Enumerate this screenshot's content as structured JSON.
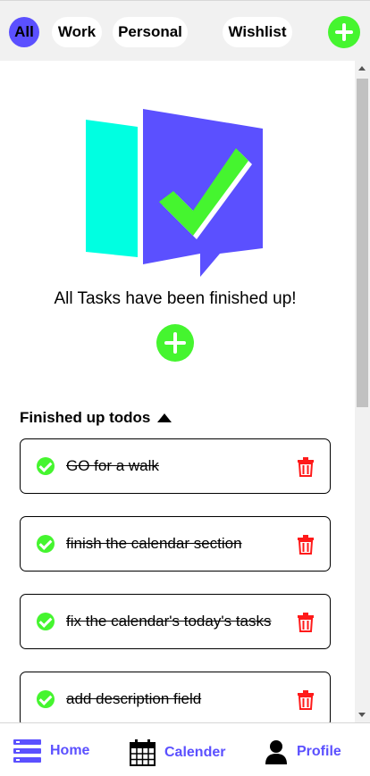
{
  "categories": [
    {
      "label": "All",
      "active": true
    },
    {
      "label": "Work",
      "active": false
    },
    {
      "label": "Personal",
      "active": false
    },
    {
      "label": "Wishlist",
      "active": false
    }
  ],
  "empty_state": {
    "message": "All Tasks have been finished up!"
  },
  "finished_section": {
    "title": "Finished up todos"
  },
  "tasks": [
    {
      "text": "GO for a walk",
      "done": true
    },
    {
      "text": "finish the calendar section",
      "done": true
    },
    {
      "text": "fix the calendar's today's tasks",
      "done": true
    },
    {
      "text": "add description field",
      "done": true
    }
  ],
  "nav": {
    "home_label": "Home",
    "calendar_label": "Calender",
    "profile_label": "Profile"
  },
  "colors": {
    "accent": "#5b50ff",
    "success": "#45f52f",
    "danger": "#ff1a1a",
    "cyan": "#00ffe1"
  }
}
